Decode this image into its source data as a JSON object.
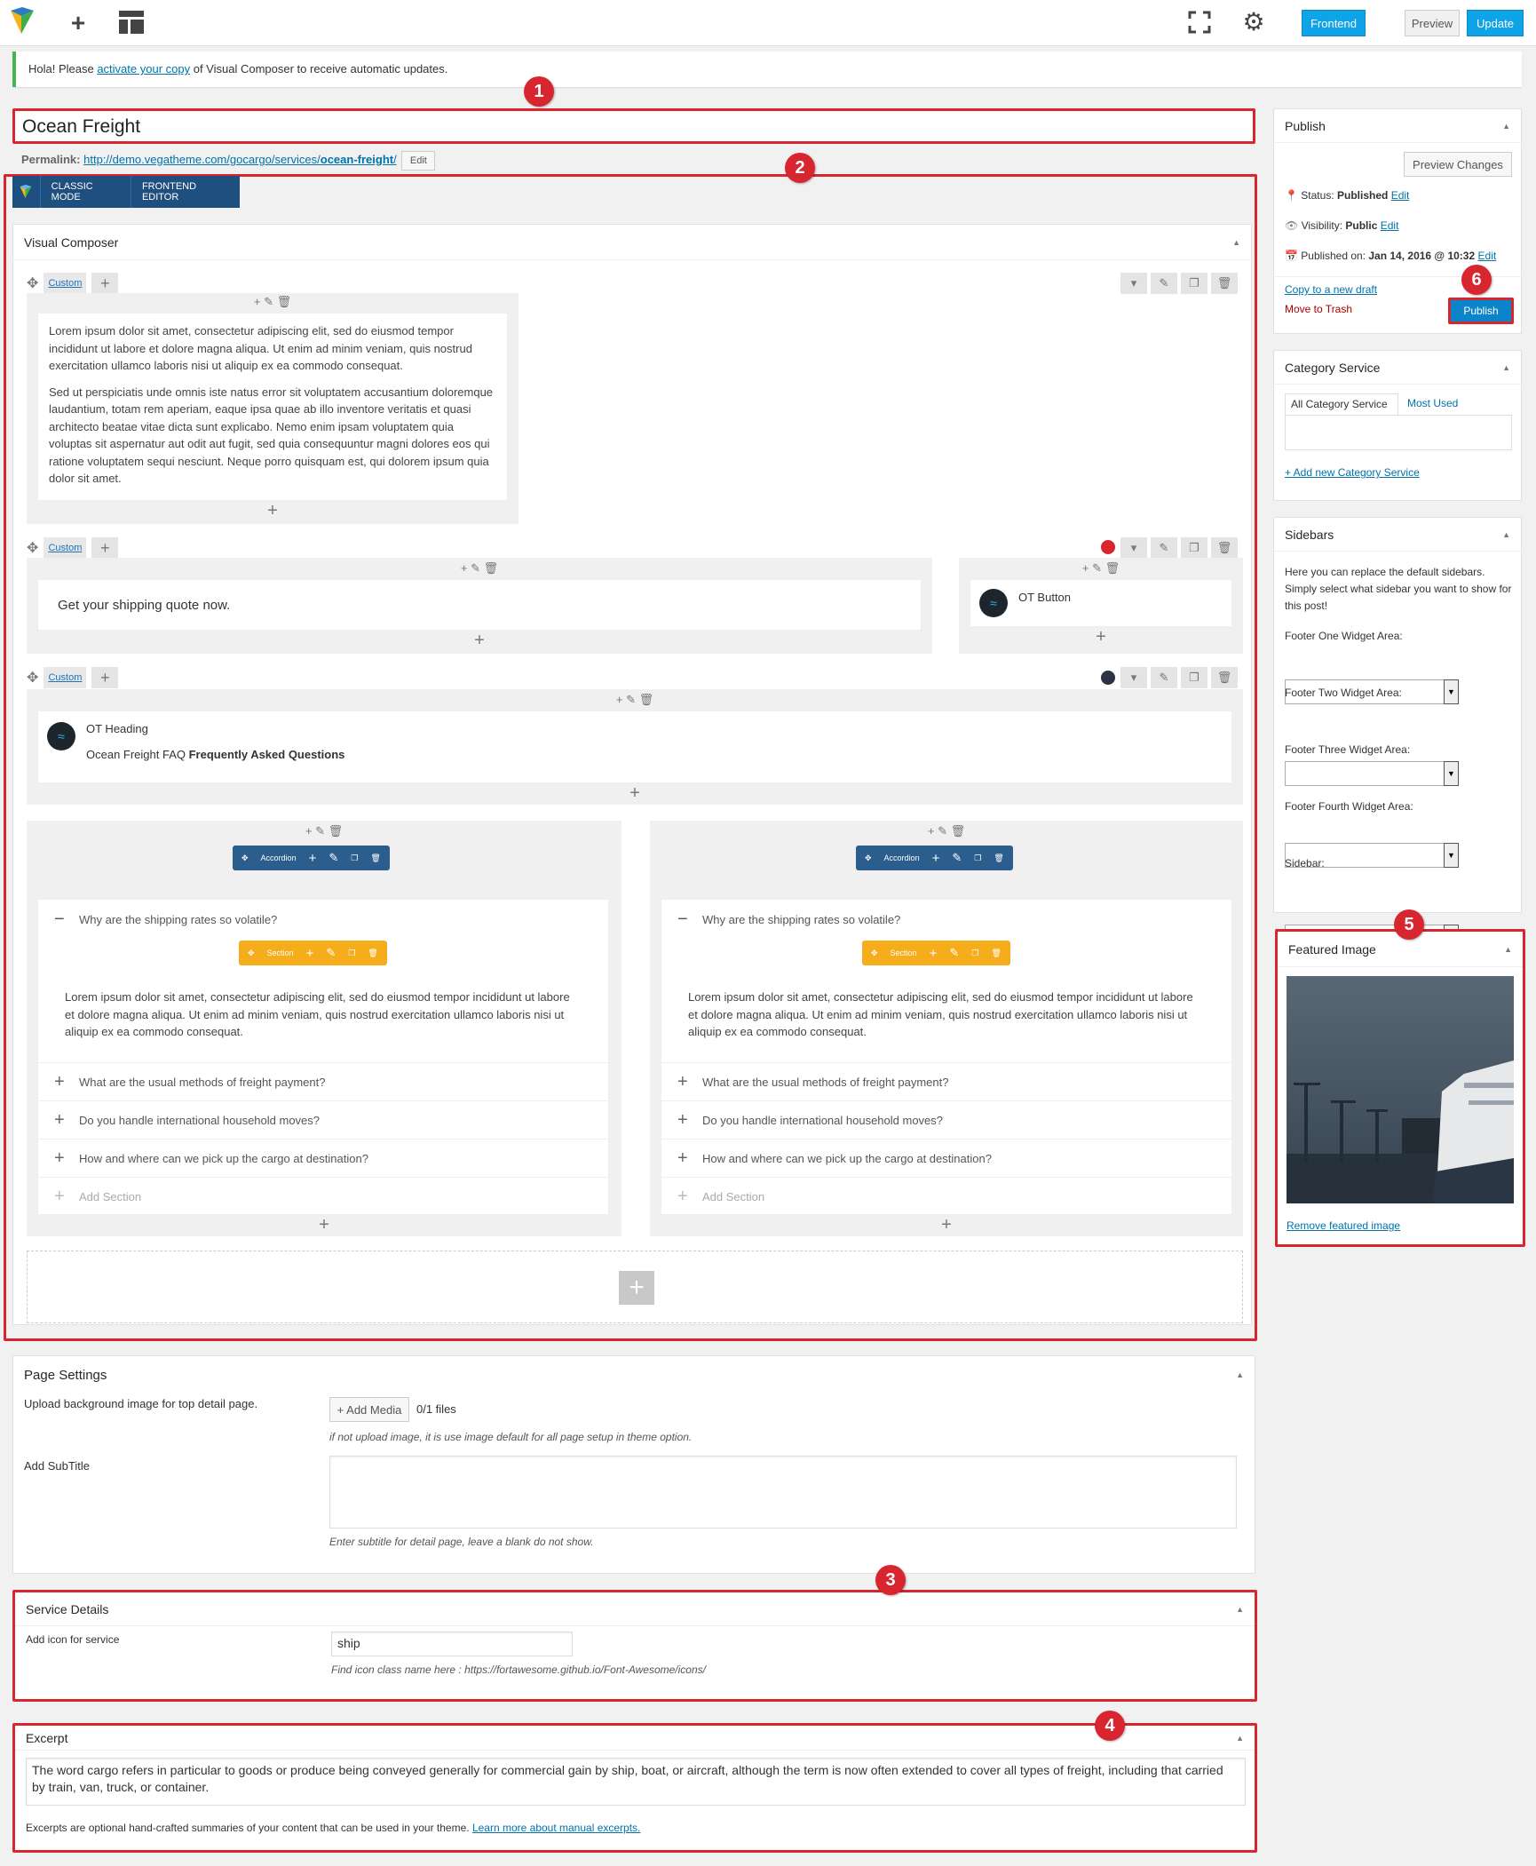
{
  "topbar": {
    "frontend": "Frontend",
    "preview": "Preview",
    "update": "Update"
  },
  "notice": {
    "before": "Hola! Please ",
    "link": "activate your copy",
    "after": " of Visual Composer to receive automatic updates."
  },
  "title": "Ocean Freight",
  "permalink": {
    "label": "Permalink:",
    "base": "http://demo.vegatheme.com/gocargo/services/",
    "slug": "ocean-freight",
    "trail": "/",
    "edit": "Edit"
  },
  "vc_modes": {
    "classic": "CLASSIC MODE",
    "frontend": "FRONTEND EDITOR"
  },
  "vc": {
    "title": "Visual Composer",
    "row_label": "Custom",
    "text1_p1": "Lorem ipsum dolor sit amet, consectetur adipiscing elit, sed do eiusmod tempor incididunt ut labore et dolore magna aliqua. Ut enim ad minim veniam, quis nostrud exercitation ullamco laboris nisi ut aliquip ex ea commodo consequat.",
    "text1_p2": "Sed ut perspiciatis unde omnis iste natus error sit voluptatem accusantium doloremque laudantium, totam rem aperiam, eaque ipsa quae ab illo inventore veritatis et quasi architecto beatae vitae dicta sunt explicabo. Nemo enim ipsam voluptatem quia voluptas sit aspernatur aut odit aut fugit, sed quia consequuntur magni dolores eos qui ratione voluptatem sequi nesciunt. Neque porro quisquam est, qui dolorem ipsum quia dolor sit amet.",
    "quote_text": "Get your shipping quote now.",
    "ot_button": "OT Button",
    "ot_heading": "OT Heading",
    "heading_sub_plain": "Ocean Freight FAQ ",
    "heading_sub_bold": "Frequently Asked Questions",
    "accordion": "Accordion",
    "section": "Section",
    "q_open": "Why are the shipping rates so volatile?",
    "answer": "Lorem ipsum dolor sit amet, consectetur adipiscing elit, sed do eiusmod tempor incididunt ut labore et dolore magna aliqua. Ut enim ad minim veniam, quis nostrud exercitation ullamco laboris nisi ut aliquip ex ea commodo consequat.",
    "questions": [
      "What are the usual methods of freight payment?",
      "Do you handle international household moves?",
      "How and where can we pick up the cargo at destination?"
    ],
    "add_section": "Add Section",
    "dot_colors": {
      "red": "#d7262f",
      "dark": "#2b3440"
    }
  },
  "publish": {
    "title": "Publish",
    "preview_changes": "Preview Changes",
    "status_label": "Status:",
    "status": "Published",
    "visibility_label": "Visibility:",
    "visibility": "Public",
    "published_label": "Published on:",
    "published": "Jan 14, 2016 @ 10:32",
    "edit": "Edit",
    "copy_draft": "Copy to a new draft",
    "trash": "Move to Trash",
    "publish": "Publish"
  },
  "category": {
    "title": "Category Service",
    "tab_all": "All Category Service",
    "tab_most": "Most Used",
    "add_new": "+ Add new Category Service"
  },
  "sidebars": {
    "title": "Sidebars",
    "desc": "Here you can replace the default sidebars. Simply select what sidebar you want to show for this post!",
    "fields": [
      "Footer One Widget Area:",
      "Footer Two Widget Area:",
      "Footer Three Widget Area:",
      "Footer Fourth Widget Area:",
      "Sidebar:"
    ]
  },
  "featured": {
    "title": "Featured Image",
    "remove": "Remove featured image"
  },
  "page_settings": {
    "title": "Page Settings",
    "upload_label": "Upload background image for top detail page.",
    "add_media": "+ Add Media",
    "files": "0/1 files",
    "upload_hint": "if not upload image, it is use image default for all page setup in theme option.",
    "subtitle_label": "Add SubTitle",
    "subtitle_hint": "Enter subtitle for detail page, leave a blank do not show."
  },
  "service": {
    "title": "Service Details",
    "icon_label": "Add icon for service",
    "icon_value": "ship",
    "icon_hint": "Find icon class name here : https://fortawesome.github.io/Font-Awesome/icons/"
  },
  "excerpt": {
    "title": "Excerpt",
    "text": "The word cargo refers in particular to goods or produce being conveyed generally for commercial gain by ship, boat, or aircraft, although the term is now often extended to cover all types of freight, including that carried by train, van, truck, or container.",
    "help": "Excerpts are optional hand-crafted summaries of your content that can be used in your theme. ",
    "help_link": "Learn more about manual excerpts."
  },
  "badges": [
    "1",
    "2",
    "3",
    "4",
    "5",
    "6"
  ]
}
